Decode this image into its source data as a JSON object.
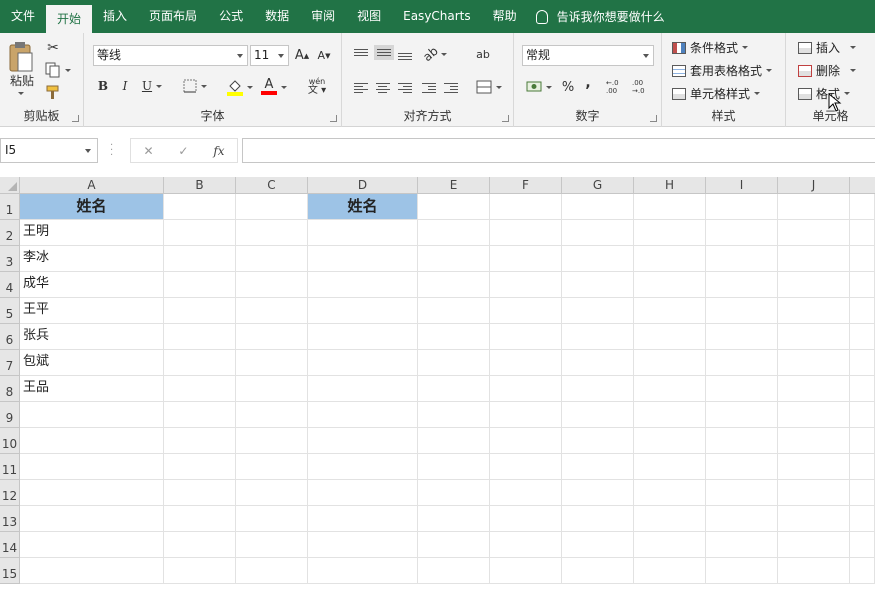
{
  "menu": {
    "tabs": [
      "文件",
      "开始",
      "插入",
      "页面布局",
      "公式",
      "数据",
      "审阅",
      "视图",
      "EasyCharts",
      "帮助"
    ],
    "active_index": 1,
    "tell_me": "告诉我你想要做什么"
  },
  "ribbon": {
    "clipboard": {
      "label": "剪贴板",
      "paste": "粘贴"
    },
    "font": {
      "label": "字体",
      "font_name": "等线",
      "font_size": "11",
      "grow": "A",
      "shrink": "A",
      "bold": "B",
      "italic": "I",
      "underline": "U",
      "font_color_glyph": "A",
      "phonetic_glyph": "wén"
    },
    "alignment": {
      "label": "对齐方式",
      "wrap_glyph": "ab"
    },
    "number": {
      "label": "数字",
      "format": "常规",
      "percent": "%",
      "comma": ",",
      "inc_decimal": "←.0 .00",
      "dec_decimal": ".00 →.0"
    },
    "styles": {
      "label": "样式",
      "conditional": "条件格式",
      "table": "套用表格格式",
      "cell_styles": "单元格样式"
    },
    "cells": {
      "label": "单元格",
      "insert": "插入",
      "delete": "删除",
      "format": "格式"
    }
  },
  "formula_bar": {
    "name_box": "I5",
    "cancel": "✕",
    "enter": "✓",
    "fx": "fx",
    "content": ""
  },
  "sheet": {
    "columns": [
      "A",
      "B",
      "C",
      "D",
      "E",
      "F",
      "G",
      "H",
      "I",
      "J"
    ],
    "rows": [
      "1",
      "2",
      "3",
      "4",
      "5",
      "6",
      "7",
      "8",
      "9",
      "10",
      "11",
      "12",
      "13",
      "14",
      "15"
    ],
    "A1": "姓名",
    "D1": "姓名",
    "names": [
      "王明",
      "李冰",
      "成华",
      "王平",
      "张兵",
      "包斌",
      "王品"
    ]
  },
  "colors": {
    "brand": "#217346",
    "header_fill": "#9dc3e6",
    "font_color_bar": "#ff0000",
    "fill_color_bar": "#ffff00"
  }
}
